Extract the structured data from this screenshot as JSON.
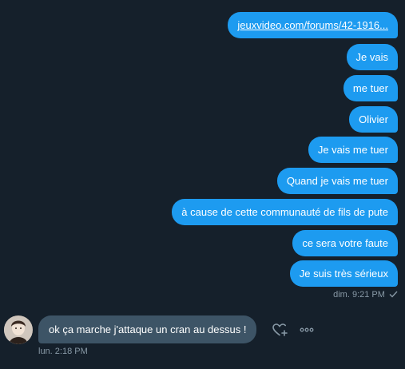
{
  "outgoing_messages": [
    {
      "text": "jeuxvideo.com/forums/42-1916...",
      "is_link": true
    },
    {
      "text": "Je vais"
    },
    {
      "text": "me tuer"
    },
    {
      "text": "Olivier"
    },
    {
      "text": "Je vais me tuer"
    },
    {
      "text": "Quand je vais me tuer"
    },
    {
      "text": "à cause de cette communauté de fils de pute"
    },
    {
      "text": "ce sera votre faute"
    },
    {
      "text": "Je suis très sérieux"
    }
  ],
  "outgoing_meta": {
    "timestamp": "dim. 9:21 PM",
    "status_icon": "check-icon"
  },
  "incoming_message": {
    "text": "ok ça marche j'attaque un cran au dessus !"
  },
  "incoming_meta": {
    "timestamp": "lun. 2:18 PM"
  },
  "actions": {
    "react_icon": "heart-plus-icon",
    "more_icon": "more-horizontal-icon"
  },
  "colors": {
    "background": "#15202b",
    "outgoing_bubble": "#1d9bf0",
    "incoming_bubble": "#3d5466",
    "meta_text": "#8899a6"
  }
}
